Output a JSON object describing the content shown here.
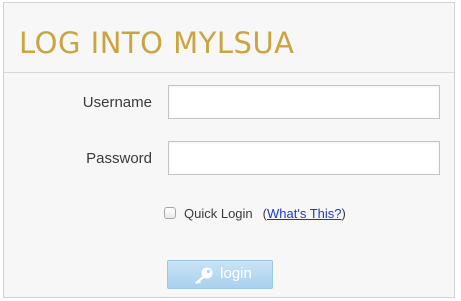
{
  "login_panel": {
    "title": "LOG INTO MYLSUA",
    "username": {
      "label": "Username",
      "value": "",
      "placeholder": ""
    },
    "password": {
      "label": "Password",
      "value": "",
      "placeholder": ""
    },
    "quick_login": {
      "label": "Quick Login",
      "checked": false,
      "help_prefix": "(",
      "help_link": "What's This?",
      "help_suffix": ")"
    },
    "login_button": {
      "label": "login",
      "icon": "key-icon"
    }
  },
  "colors": {
    "title": "#c9a43f",
    "link": "#1a37c9",
    "button_bg": "#b7daf2"
  }
}
